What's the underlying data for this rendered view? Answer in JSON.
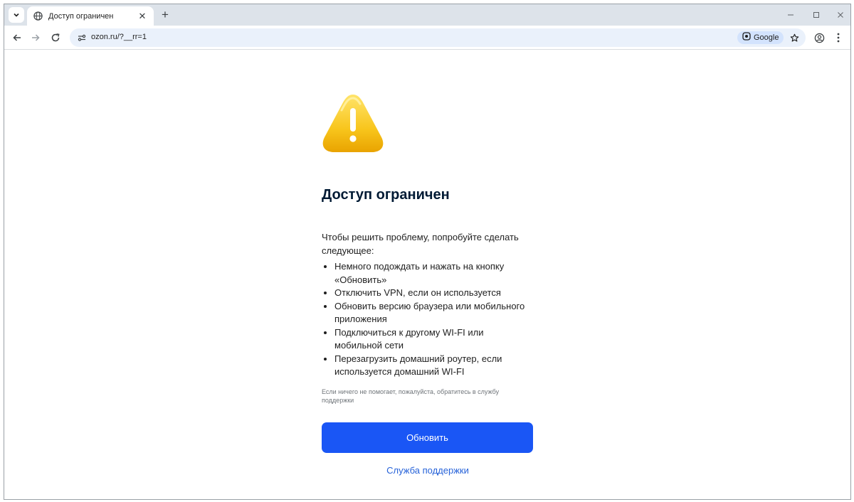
{
  "browser": {
    "tab": {
      "title": "Доступ ограничен"
    },
    "address_bar": {
      "url": "ozon.ru/?__rr=1",
      "search_chip": "Google"
    }
  },
  "page": {
    "heading": "Доступ ограничен",
    "intro": "Чтобы решить проблему, попробуйте сделать следующее:",
    "steps": [
      "Немного подождать и нажать на кнопку «Обновить»",
      "Отключить VPN, если он используется",
      "Обновить версию браузера или мобильного приложения",
      "Подключиться к другому WI-FI или мобильной сети",
      "Перезагрузить домашний роутер, если используется домашний WI-FI"
    ],
    "note": "Если ничего не помогает, пожалуйста, обратитесь в службу поддержки",
    "refresh_button": "Обновить",
    "support_link": "Служба поддержки"
  },
  "colors": {
    "primary_button": "#1a56f5",
    "link": "#2662d9",
    "warning_icon": "#f5b800"
  },
  "icons": [
    "tab-search-icon",
    "globe-icon",
    "close-icon",
    "plus-icon",
    "minimize-icon",
    "maximize-icon",
    "back-arrow-icon",
    "forward-arrow-icon",
    "reload-icon",
    "site-settings-icon",
    "google-lens-icon",
    "star-icon",
    "profile-icon",
    "kebab-menu-icon",
    "warning-icon"
  ]
}
